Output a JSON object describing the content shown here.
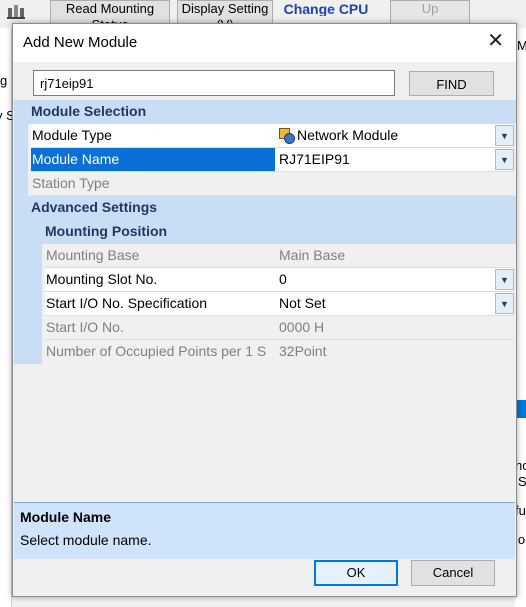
{
  "background": {
    "toolbar_buttons": [
      "Read Mounting Status",
      "Display Setting (V)",
      "Change CPU",
      "Up"
    ],
    "fragments_left": [
      "g",
      "y S"
    ],
    "fragments_right": [
      "M",
      "ho",
      "S",
      "fu",
      "io"
    ]
  },
  "dialog": {
    "title": "Add New Module",
    "search_value": "rj71eip91",
    "find_label": "FIND",
    "sections": {
      "module_selection": "Module Selection",
      "advanced_settings": "Advanced Settings",
      "mounting_position": "Mounting Position"
    },
    "properties": {
      "module_type": {
        "label": "Module Type",
        "value": "Network Module"
      },
      "module_name": {
        "label": "Module Name",
        "value": "RJ71EIP91"
      },
      "station_type": {
        "label": "Station Type",
        "value": ""
      },
      "mounting_base": {
        "label": "Mounting Base",
        "value": "Main Base"
      },
      "mounting_slot": {
        "label": "Mounting Slot No.",
        "value": "0"
      },
      "start_io_spec": {
        "label": "Start I/O No. Specification",
        "value": "Not Set"
      },
      "start_io_no": {
        "label": "Start I/O No.",
        "value": "0000 H"
      },
      "occupied_points": {
        "label": "Number of Occupied Points per 1 S",
        "value": "32Point"
      }
    },
    "description": {
      "title": "Module Name",
      "text": "Select module name."
    },
    "ok_label": "OK",
    "cancel_label": "Cancel",
    "colors": {
      "accent": "#0078d7",
      "selected": "#0a6fd6",
      "section_bg": "#c9def5",
      "section_text": "#1f3864"
    }
  }
}
